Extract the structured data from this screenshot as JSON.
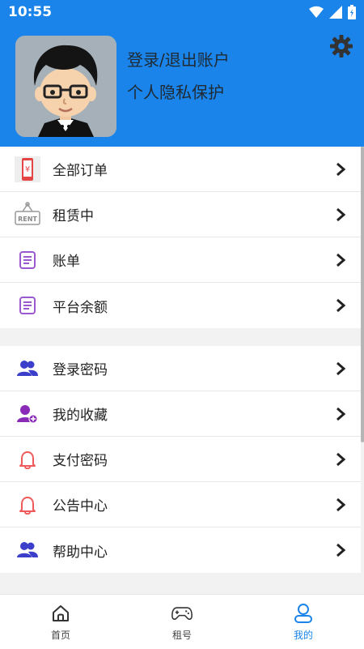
{
  "status_bar": {
    "time": "10:55"
  },
  "header": {
    "login_link": "登录/退出账户",
    "privacy_link": "个人隐私保护",
    "accent": "#1a84ea"
  },
  "menu_group_1": [
    {
      "label": "全部订单",
      "icon": "phone-yuan-icon"
    },
    {
      "label": "租赁中",
      "icon": "rent-sign-icon"
    },
    {
      "label": "账单",
      "icon": "bill-icon"
    },
    {
      "label": "平台余额",
      "icon": "balance-icon"
    }
  ],
  "menu_group_2": [
    {
      "label": "登录密码",
      "icon": "users-icon"
    },
    {
      "label": "我的收藏",
      "icon": "user-add-icon"
    },
    {
      "label": "支付密码",
      "icon": "bell-icon"
    },
    {
      "label": "公告中心",
      "icon": "bell-icon"
    },
    {
      "label": "帮助中心",
      "icon": "users-icon"
    }
  ],
  "bottom_nav": [
    {
      "label": "首页",
      "icon": "home-icon",
      "active": false
    },
    {
      "label": "租号",
      "icon": "gamepad-icon",
      "active": false
    },
    {
      "label": "我的",
      "icon": "person-icon",
      "active": true
    }
  ]
}
